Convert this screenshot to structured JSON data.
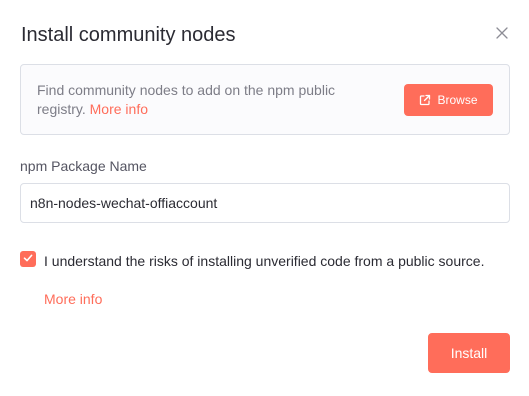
{
  "dialog": {
    "title": "Install community nodes",
    "close_icon": "close-icon"
  },
  "info": {
    "text": "Find community nodes to add on the npm public registry.",
    "more_info_label": "More info",
    "browse_label": "Browse",
    "browse_icon": "external-link-icon"
  },
  "package": {
    "label": "npm Package Name",
    "value": "n8n-nodes-wechat-offiaccount"
  },
  "risk": {
    "checked": true,
    "text": "I understand the risks of installing unverified code from a public source.",
    "more_info_label": "More info"
  },
  "actions": {
    "install_label": "Install"
  },
  "colors": {
    "accent": "#ff6d5a",
    "text": "#2b2b33",
    "muted": "#7d7d87",
    "border": "#dcdfe6"
  }
}
